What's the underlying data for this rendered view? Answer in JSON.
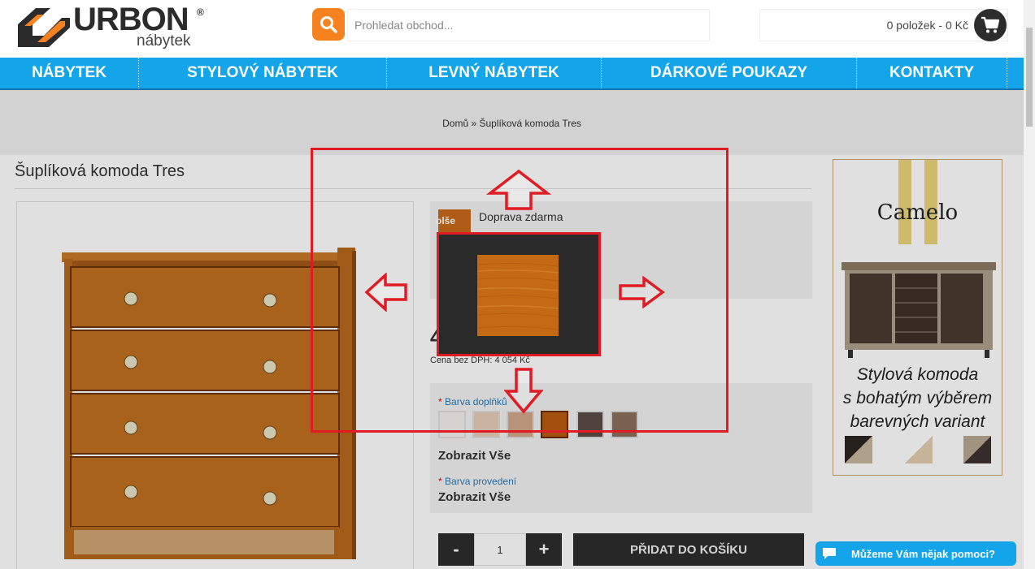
{
  "header": {
    "logo_text": "URBON",
    "logo_reg": "®",
    "logo_sub": "nábytek",
    "search_placeholder": "Prohledat obchod...",
    "cart_text": "0 položek - 0 Kč"
  },
  "nav": {
    "items": [
      {
        "label": "NÁBYTEK"
      },
      {
        "label": "STYLOVÝ NÁBYTEK"
      },
      {
        "label": "LEVNÝ NÁBYTEK"
      },
      {
        "label": "DÁRKOVÉ POUKAZY"
      },
      {
        "label": "KONTAKTY"
      }
    ]
  },
  "breadcrumb": "Domů » Šuplíková komoda Tres",
  "product": {
    "title": "Šuplíková komoda Tres",
    "shipping_label": "Doprava zdarma",
    "shipping_tag": "olše",
    "price_partial": "4",
    "price_nodph": "Cena bez DPH: 4 054 Kč",
    "option1_label": "Barva doplňků",
    "option2_label": "Barva provedení",
    "show_all": "Zobrazit Vše",
    "quantity": "1",
    "minus": "-",
    "plus": "+",
    "add_to_cart": "PŘIDAT DO KOŠÍKU"
  },
  "ad": {
    "title": "Camelo",
    "text_line1": "Stylová komoda",
    "text_line2": "s bohatým výběrem",
    "text_line3": "barevných variant"
  },
  "chat": {
    "label": "Můžeme Vám nějak pomoci?"
  },
  "colors": {
    "nav_blue": "#14a4ea",
    "accent_orange": "#f5821f",
    "highlight_red": "#e01b24",
    "dark": "#2d2d2d"
  }
}
